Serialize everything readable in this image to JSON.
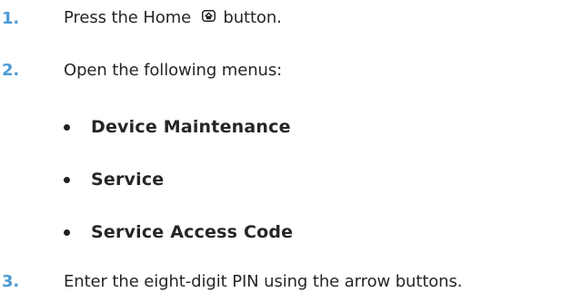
{
  "colors": {
    "step_number": "#4d9ad6",
    "text": "#262626"
  },
  "steps": [
    {
      "number": "1.",
      "text_before_icon": "Press the Home",
      "icon": "home-icon",
      "text_after_icon": "button."
    },
    {
      "number": "2.",
      "text": "Open the following menus:"
    },
    {
      "number": "3.",
      "text": "Enter the eight-digit PIN using the arrow buttons."
    }
  ],
  "menus": [
    "Device Maintenance",
    "Service",
    "Service Access Code"
  ]
}
